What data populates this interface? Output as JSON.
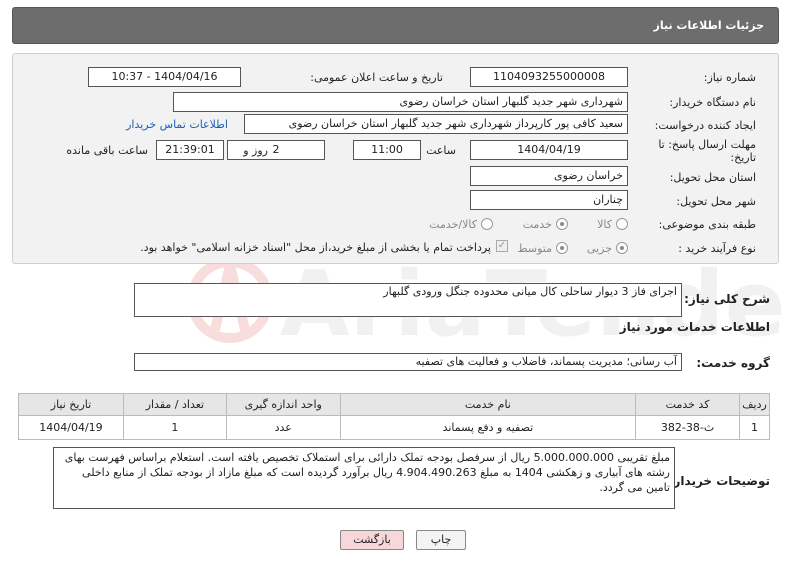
{
  "title": "جزئیات اطلاعات نیاز",
  "labels": {
    "need_number": "شماره نیاز:",
    "announce_datetime": "تاریخ و ساعت اعلان عمومی:",
    "buyer_org": "نام دستگاه خریدار:",
    "requester": "ایجاد کننده درخواست:",
    "deadline": "مهلت ارسال پاسخ: تا تاریخ:",
    "time": "ساعت",
    "days_and": "روز و",
    "remaining": "ساعت باقی مانده",
    "province": "استان محل تحویل:",
    "city": "شهر محل تحویل:",
    "category": "طبقه بندی موضوعی:",
    "process_type": "نوع فرآیند خرید :",
    "general_desc": "شرح کلی نیاز:",
    "services_info": "اطلاعات خدمات مورد نیاز",
    "service_group": "گروه خدمت:",
    "buyer_notes": "توضیحات خریدار:"
  },
  "fields": {
    "need_number": "1104093255000008",
    "announce_datetime": "1404/04/16 - 10:37",
    "buyer_org": "شهرداری شهر جدید گلبهار استان خراسان رضوی",
    "requester": "سعید کافی پور کارپرداز شهرداری شهر جدید گلبهار استان خراسان رضوی",
    "contact_link": "اطلاعات تماس خریدار",
    "deadline_date": "1404/04/19",
    "deadline_time": "11:00",
    "days": "2",
    "remaining_time": "21:39:01",
    "province": "خراسان رضوی",
    "city": "چناران",
    "general_desc": "اجرای فاز 3 دیوار ساحلی کال میانی محدوده جنگل ورودی گلبهار",
    "service_group": "آب رسانی؛ مدیریت پسماند، فاضلاب و فعالیت های تصفیه"
  },
  "category_options": [
    "کالا",
    "خدمت",
    "کالا/خدمت"
  ],
  "category_selected": "خدمت",
  "process_options": [
    "جزیی",
    "متوسط"
  ],
  "process_selected": "جزیی",
  "payment_note": "پرداخت تمام یا بخشی از مبلغ خرید،از محل \"اسناد خزانه اسلامی\" خواهد بود.",
  "table": {
    "headers": [
      "ردیف",
      "کد خدمت",
      "نام خدمت",
      "واحد اندازه گیری",
      "تعداد / مقدار",
      "تاریخ نیاز"
    ],
    "rows": [
      [
        "1",
        "ث-38-382",
        "تصفیه و دفع پسماند",
        "عدد",
        "1",
        "1404/04/19"
      ]
    ]
  },
  "buyer_notes": "مبلغ تقریبی 5.000.000.000 ریال از سرفصل بودجه تملک دارائی برای استملاک تخصیص یافته است. استعلام براساس فهرست بهای رشته های آبیاری و زهکشی 1404 به مبلغ 4.904.490.263 ریال برآورد گردیده است که مبلغ مازاد از بودجه تملک از منابع داخلی تامین می گردد.",
  "buttons": {
    "print": "چاپ",
    "back": "بازگشت"
  },
  "watermark": "AriaTender.neT",
  "colors": {
    "titlebar": "#6d6d6d",
    "panel": "#f2f2f2",
    "link": "#1a5fb4",
    "back_button": "#f8d7da"
  }
}
